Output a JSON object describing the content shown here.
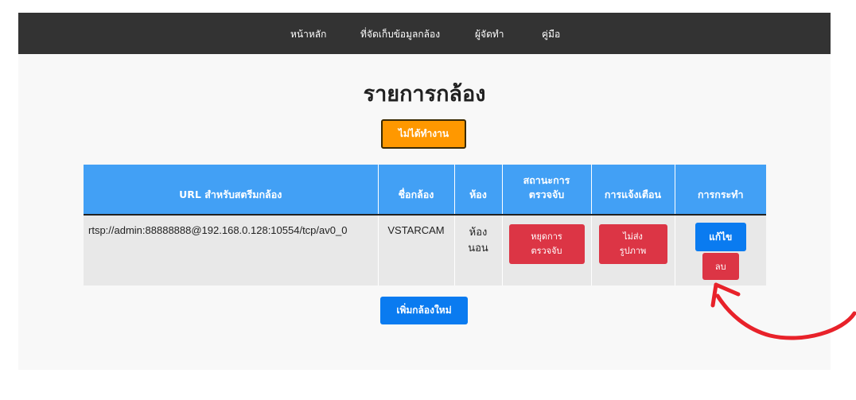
{
  "nav": {
    "items": [
      {
        "label": "หน้าหลัก"
      },
      {
        "label": "ที่จัดเก็บข้อมูลกล้อง"
      },
      {
        "label": "ผู้จัดทำ"
      },
      {
        "label": "คู่มือ"
      }
    ]
  },
  "main": {
    "title": "รายการกล้อง",
    "status_button": "ไม่ได้ทำงาน",
    "add_button": "เพิ่มกล้องใหม่"
  },
  "table": {
    "headers": {
      "url": "URL สำหรับสตรีมกล้อง",
      "name": "ชื่อกล้อง",
      "room": "ห้อง",
      "detection_line1": "สถานะการ",
      "detection_line2": "ตรวจจับ",
      "notification": "การแจ้งเตือน",
      "action": "การกระทำ"
    },
    "rows": [
      {
        "url": "rtsp://admin:88888888@192.168.0.128:10554/tcp/av0_0",
        "name": "VSTARCAM",
        "room_line1": "ห้อง",
        "room_line2": "นอน",
        "detection_button_line1": "หยุดการ",
        "detection_button_line2": "ตรวจจับ",
        "notify_button_line1": "ไม่ส่ง",
        "notify_button_line2": "รูปภาพ",
        "edit_button": "แก้ไข",
        "delete_button": "ลบ"
      }
    ]
  },
  "colors": {
    "navbar": "#333333",
    "status_orange": "#ff9800",
    "table_header_blue": "#42a0f5",
    "primary_blue": "#0a7bf0",
    "danger_red": "#dc3545",
    "annotation_arrow": "#e8222a"
  },
  "icons": [
    "annotation-arrow"
  ]
}
